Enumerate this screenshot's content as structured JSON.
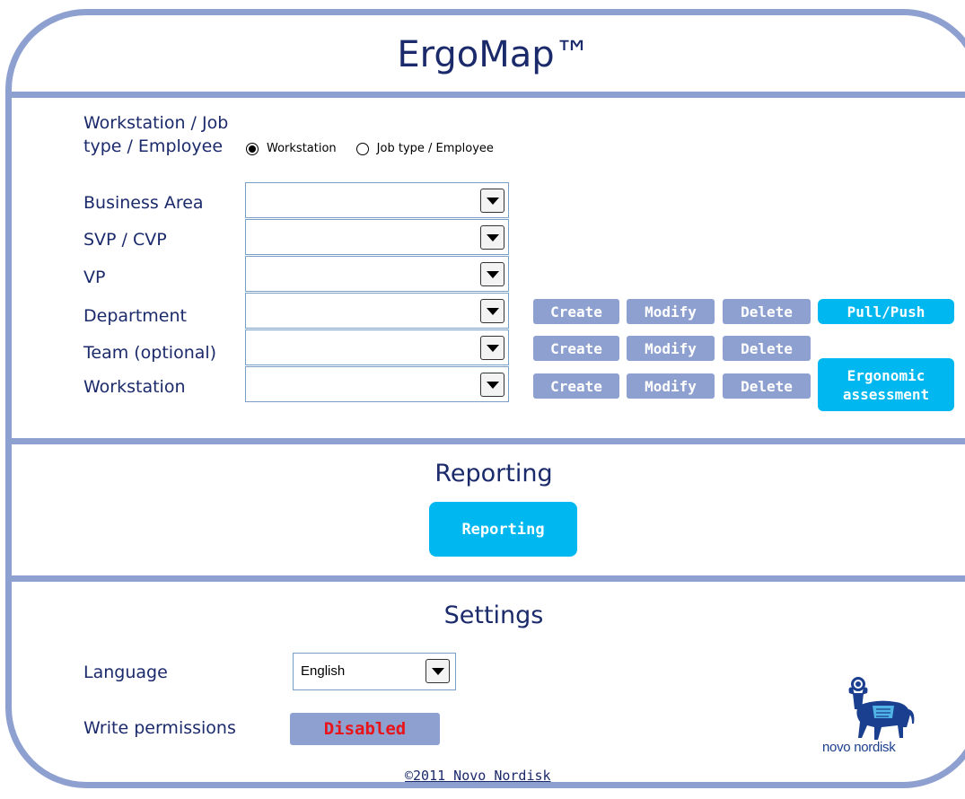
{
  "app": {
    "title": "ErgoMap™"
  },
  "selection": {
    "mode_label": "Workstation / Job type / Employee",
    "radio_options": [
      {
        "label": "Workstation",
        "selected": true
      },
      {
        "label": "Job type / Employee",
        "selected": false
      }
    ],
    "fields": [
      {
        "label": "Business Area",
        "value": ""
      },
      {
        "label": "SVP / CVP",
        "value": ""
      },
      {
        "label": "VP",
        "value": ""
      },
      {
        "label": "Department",
        "value": ""
      },
      {
        "label": "Team (optional)",
        "value": ""
      },
      {
        "label": "Workstation",
        "value": ""
      }
    ],
    "actions": {
      "create": "Create",
      "modify": "Modify",
      "delete": "Delete",
      "pull_push": "Pull/Push",
      "ergonomic_assessment": "Ergonomic assessment"
    }
  },
  "reporting": {
    "section_title": "Reporting",
    "button_label": "Reporting"
  },
  "settings": {
    "section_title": "Settings",
    "language_label": "Language",
    "language_value": "English",
    "write_permissions_label": "Write permissions",
    "write_permissions_value": "Disabled"
  },
  "footer": {
    "copyright": "©2011 Novo Nordisk"
  },
  "logo": {
    "text": "novo nordisk",
    "icon": "apis-bull-logo"
  },
  "colors": {
    "frame": "#8ea0cf",
    "accent": "#00b8ef",
    "text": "#1b2a6b",
    "disabled": "#e8141a"
  }
}
